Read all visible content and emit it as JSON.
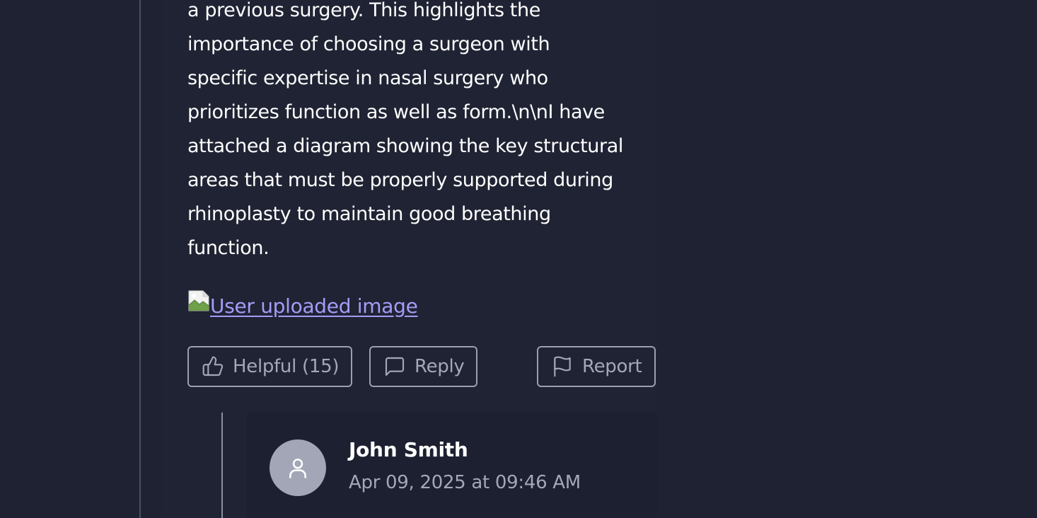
{
  "comment": {
    "body_lines": [
      "a previous surgery. This highlights the",
      "importance of choosing a surgeon with",
      "specific expertise in nasal surgery who",
      "prioritizes function as well as form.\\n\\nI have",
      "attached a diagram showing the key structural",
      "areas that must be properly supported during",
      "rhinoplasty to maintain good breathing",
      "function."
    ],
    "image_link_text": "User uploaded image",
    "actions": {
      "helpful_label": "Helpful (15)",
      "reply_label": "Reply",
      "report_label": "Report"
    }
  },
  "reply": {
    "author_name": "John Smith",
    "timestamp": "Apr 09, 2025 at 09:46 AM"
  },
  "icons": {
    "helpful": "thumbs-up-icon",
    "reply": "chat-bubble-icon",
    "report": "flag-icon",
    "avatar": "user-icon",
    "image": "broken-image-icon"
  },
  "colors": {
    "background": "#1e2232",
    "link": "#a59cf8",
    "muted_text": "#a3a8b8",
    "avatar_bg": "#a2a6b6"
  }
}
